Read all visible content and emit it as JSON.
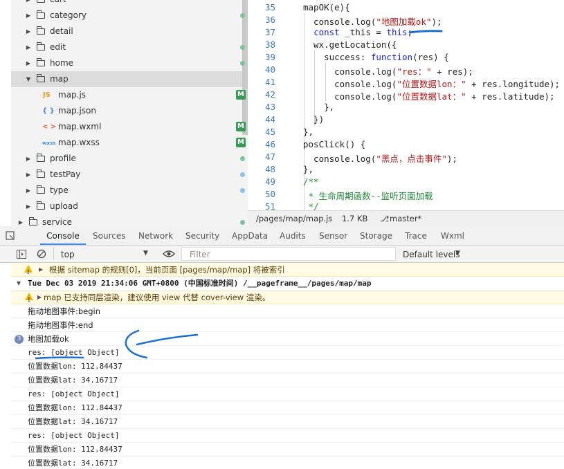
{
  "tree": {
    "items": [
      {
        "label": "cart",
        "type": "folder",
        "status": "none"
      },
      {
        "label": "category",
        "type": "folder",
        "status": "green"
      },
      {
        "label": "detail",
        "type": "folder",
        "status": "none"
      },
      {
        "label": "edit",
        "type": "folder",
        "status": "green"
      },
      {
        "label": "home",
        "type": "folder",
        "status": "green"
      },
      {
        "label": "map",
        "type": "folder-open",
        "status": "none"
      },
      {
        "label": "map.js",
        "type": "file",
        "icon": "JS",
        "status": "M"
      },
      {
        "label": "map.json",
        "type": "file",
        "icon": "{ }",
        "status": "none"
      },
      {
        "label": "map.wxml",
        "type": "file",
        "icon": "< >",
        "status": "M"
      },
      {
        "label": "map.wxss",
        "type": "file",
        "icon": "wxss",
        "status": "M"
      },
      {
        "label": "profile",
        "type": "folder",
        "status": "green"
      },
      {
        "label": "testPay",
        "type": "folder",
        "status": "blue"
      },
      {
        "label": "type",
        "type": "folder",
        "status": "blue"
      },
      {
        "label": "upload",
        "type": "folder",
        "status": "none"
      },
      {
        "label": "service",
        "type": "folder",
        "status": "green"
      }
    ],
    "m_badge": "M"
  },
  "editor": {
    "line_numbers": [
      "35",
      "36",
      "37",
      "38",
      "39",
      "40",
      "41",
      "42",
      "43",
      "44",
      "45",
      "46",
      "47",
      "48",
      "49",
      "50",
      "51"
    ]
  },
  "statusbar": {
    "path": "/pages/map/map.js",
    "size": "1.7 KB",
    "branch": "master*"
  },
  "devtools": {
    "tabs": [
      "Console",
      "Sources",
      "Network",
      "Security",
      "AppData",
      "Audits",
      "Sensor",
      "Storage",
      "Trace",
      "Wxml"
    ],
    "context": "top",
    "filter_placeholder": "Filter",
    "levels": "Default levels"
  },
  "console": {
    "sitemap_warning": "根据 sitemap 的规则[0]，当前页面 [pages/map/map] 将被索引",
    "pageframe_header": "Tue Dec 03 2019 21:34:06 GMT+0800 (中国标准时间) /__pageframe__/pages/map/map",
    "map_warning": "map 已支持同层渲染，建议使用 view 代替 cover-view 渲染。",
    "drag_begin": "拖动地图事件:begin",
    "drag_end": "拖动地图事件:end",
    "load_count": "3",
    "load_ok": "地图加载ok",
    "repeated": [
      "res: [object Object]",
      "位置数据lon: 112.84437",
      "位置数据lat: 34.16717",
      "res: [object Object]",
      "位置数据lon: 112.84437",
      "位置数据lat: 34.16717",
      "res: [object Object]",
      "位置数据lon: 112.84437",
      "位置数据lat: 34.16717"
    ]
  },
  "colors": {
    "accent": "#4285f4",
    "annotation": "#1a6fd1",
    "git_modified": "#3a9a55"
  }
}
